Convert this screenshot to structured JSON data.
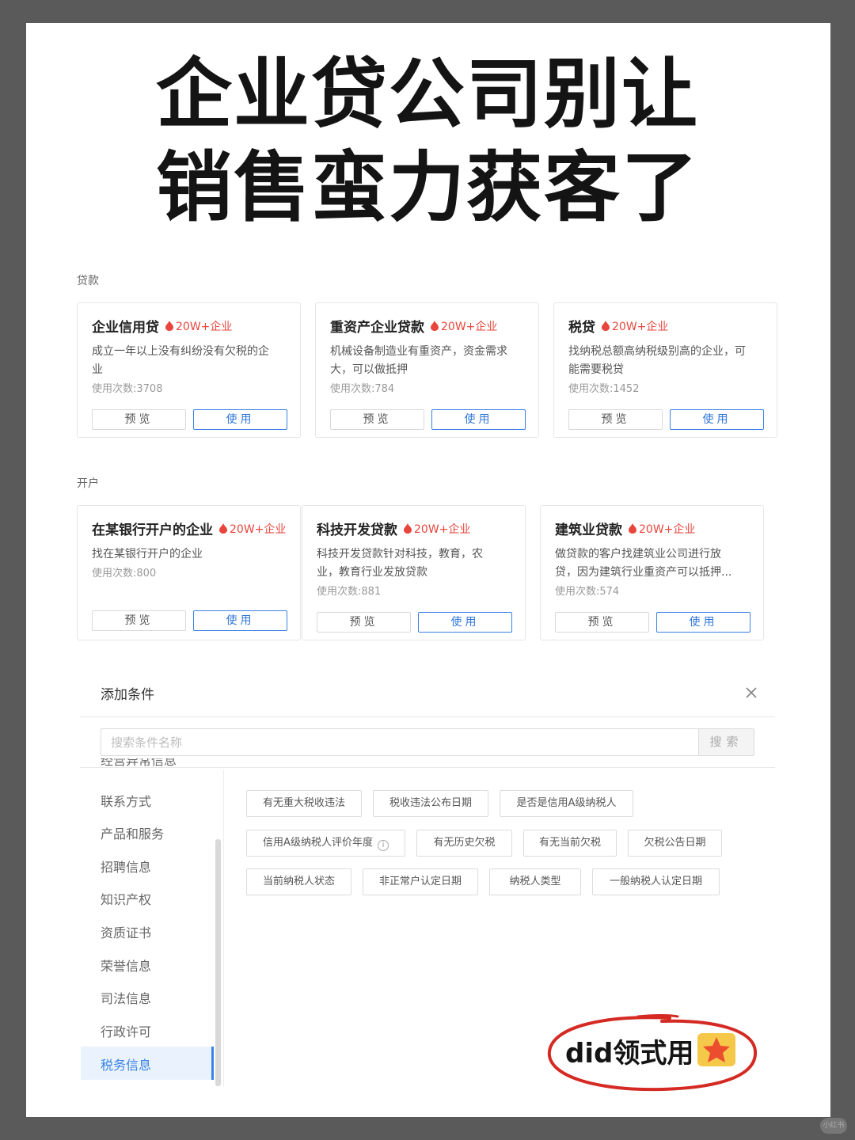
{
  "headline": {
    "line1": "企业贷公司别让",
    "line2": "销售蛮力获客了"
  },
  "sections": [
    {
      "label": "贷款"
    },
    {
      "label": "开户"
    }
  ],
  "tag_text": "20W+企业",
  "cards": [
    {
      "title": "企业信用贷",
      "desc1": "成立一年以上没有纠纷没有欠税的企",
      "desc2": "业",
      "uses": "使用次数:3708",
      "preview": "预览",
      "use": "使用"
    },
    {
      "title": "重资产企业贷款",
      "desc1": "机械设备制造业有重资产，资金需求",
      "desc2": "大，可以做抵押",
      "uses": "使用次数:784",
      "preview": "预览",
      "use": "使用"
    },
    {
      "title": "税贷",
      "desc1": "找纳税总额高纳税级别高的企业，可",
      "desc2": "能需要税贷",
      "uses": "使用次数:1452",
      "preview": "预览",
      "use": "使用"
    },
    {
      "title": "在某银行开户的企业",
      "desc1": "找在某银行开户的企业",
      "desc2": "",
      "uses": "使用次数:800",
      "preview": "预览",
      "use": "使用"
    },
    {
      "title": "科技开发贷款",
      "desc1": "科技开发贷款针对科技，教育，农",
      "desc2": "业，教育行业发放贷款",
      "uses": "使用次数:881",
      "preview": "预览",
      "use": "使用"
    },
    {
      "title": "建筑业贷款",
      "desc1": "做贷款的客户找建筑业公司进行放",
      "desc2": "贷，因为建筑行业重资产可以抵押...",
      "uses": "使用次数:574",
      "preview": "预览",
      "use": "使用"
    }
  ],
  "panel": {
    "title": "添加条件",
    "search_placeholder": "搜索条件名称",
    "search_button": "搜索",
    "cut_item": "经营异常信息",
    "sidebar": [
      "联系方式",
      "产品和服务",
      "招聘信息",
      "知识产权",
      "资质证书",
      "荣誉信息",
      "司法信息",
      "行政许可"
    ],
    "sidebar_active": "税务信息",
    "chips": [
      "有无重大税收违法",
      "税收违法公布日期",
      "是否是信用A级纳税人",
      "信用A级纳税人评价年度",
      "有无历史欠税",
      "有无当前欠税",
      "欠税公告日期",
      "当前纳税人状态",
      "非正常户认定日期",
      "纳税人类型",
      "一般纳税人认定日期"
    ]
  },
  "stamp": {
    "text": "did领式用",
    "icon": "star-icon"
  },
  "watermark": "小红书",
  "colors": {
    "accent": "#3a82e6",
    "tag": "#e8453c",
    "stamp_ring": "#d42a23",
    "star": "#f6c84a"
  }
}
